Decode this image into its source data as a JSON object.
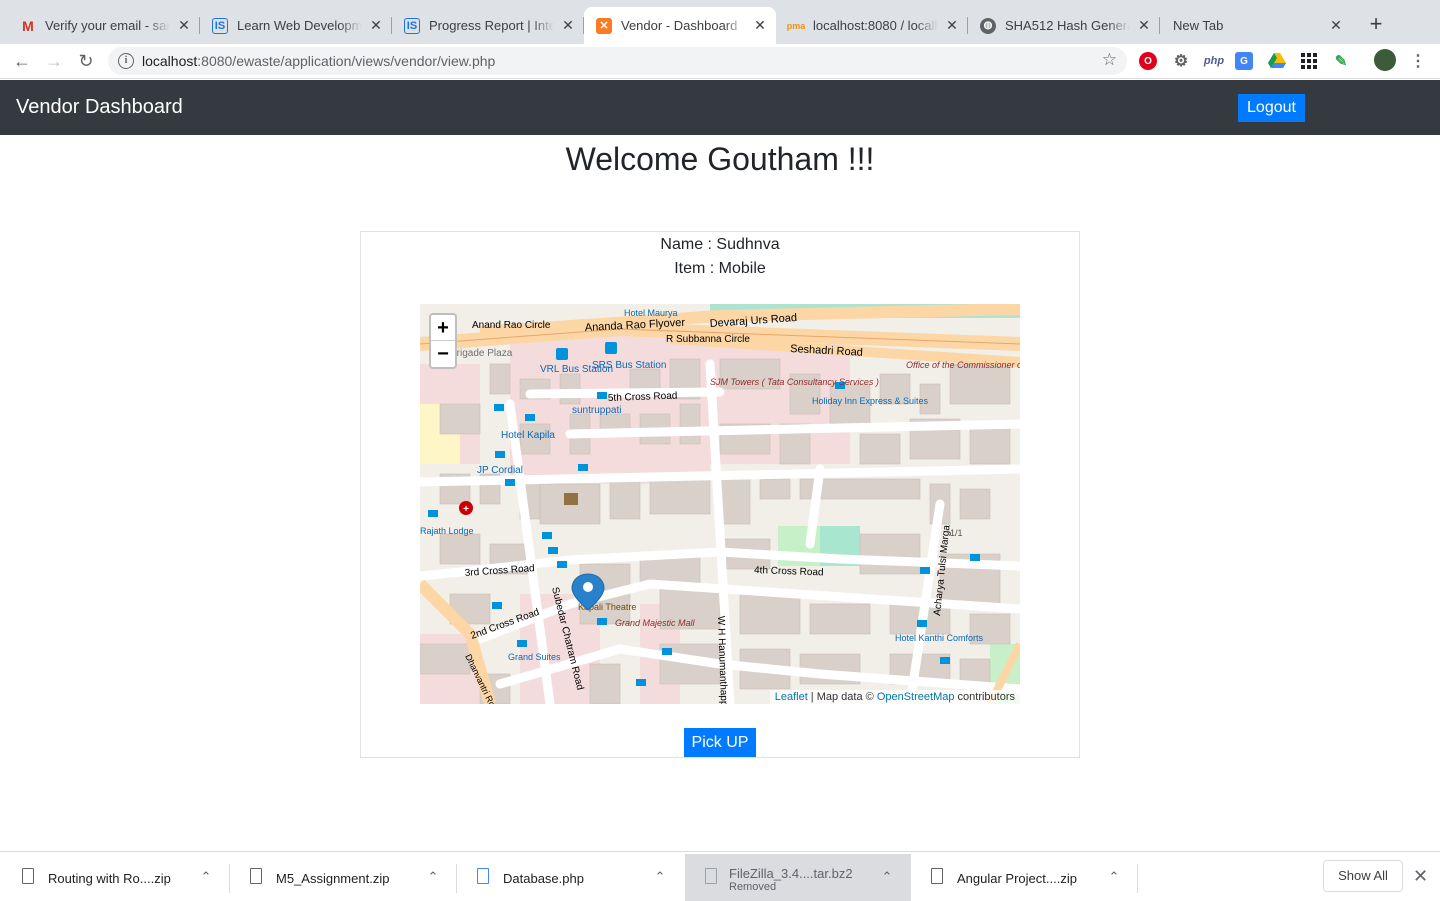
{
  "browser": {
    "tabs": [
      {
        "title": "Verify your email - san",
        "favicon": "gmail-icon"
      },
      {
        "title": "Learn Web Development",
        "favicon": "ls-icon"
      },
      {
        "title": "Progress Report | Inter",
        "favicon": "ls-icon"
      },
      {
        "title": "Vendor - Dashboard",
        "favicon": "xampp-icon",
        "active": true
      },
      {
        "title": "localhost:8080 / localh",
        "favicon": "phpmyadmin-icon"
      },
      {
        "title": "SHA512 Hash Generato",
        "favicon": "globe-icon"
      },
      {
        "title": "New Tab",
        "favicon": ""
      }
    ],
    "address": {
      "host": "localhost",
      "path": ":8080/ewaste/application/views/vendor/view.php"
    },
    "extensions": [
      "opera-icon",
      "settings-extension-icon",
      "php-icon",
      "translate-icon",
      "drive-icon",
      "apps-grid-icon",
      "feather-icon",
      "profile-avatar"
    ]
  },
  "page": {
    "brand": "Vendor Dashboard",
    "logout_label": "Logout",
    "welcome": "Welcome Goutham !!!",
    "name_line": "Name : Sudhnva",
    "item_line": "Item : Mobile",
    "pickup_label": "Pick UP",
    "map": {
      "zoom_in": "+",
      "zoom_out": "−",
      "attribution_leaflet": "Leaflet",
      "attribution_mid": " | Map data © ",
      "attribution_osm": "OpenStreetMap",
      "attribution_end": " contributors",
      "labels": [
        "Anand Rao Circle",
        "Ananda Rao Flyover",
        "Hotel Maurya",
        "R Subbanna Circle",
        "Seshadri Road",
        "Brigade Plaza",
        "VRL Bus Station",
        "SRS Bus Station",
        "5th Cross Road",
        "suntruppati",
        "SJM Towers ( Tata Consultancy Services )",
        "Holiday Inn Express & Suites",
        "Office of the Commissioner of Railway Safety",
        "Hotel Kapila",
        "JP Cordial",
        "Rajath Lodge",
        "3rd Cross Road",
        "4th Cross Road",
        "Subedar Chatram Road",
        "Kapali Theatre",
        "Grand Majestic Mall",
        "W H Hanumanthappa Road",
        "Acharya Tulsi Marga",
        "Hotel Kanthi Comforts",
        "2nd Cross Road",
        "Grand Suites",
        "Dhanvantri Road",
        "1/1",
        "Devaraj Urs Road"
      ]
    }
  },
  "downloads": [
    {
      "name": "Routing with Ro....zip",
      "status": ""
    },
    {
      "name": "M5_Assignment.zip",
      "status": ""
    },
    {
      "name": "Database.php",
      "status": ""
    },
    {
      "name": "FileZilla_3.4....tar.bz2",
      "status": "Removed"
    },
    {
      "name": "Angular Project....zip",
      "status": ""
    }
  ],
  "show_all_label": "Show All"
}
